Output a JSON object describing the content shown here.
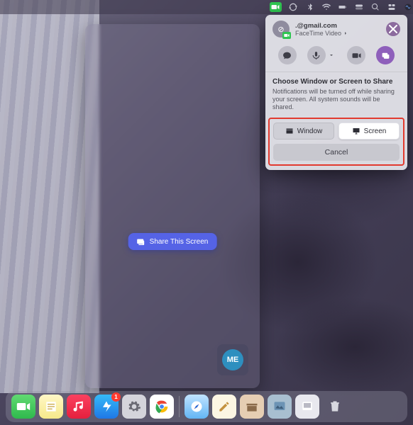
{
  "menubar": {
    "icons": [
      "facetime-icon",
      "sync-icon",
      "bluetooth-icon",
      "wifi-icon",
      "battery-icon",
      "toggle-icon",
      "search-icon",
      "control-center-icon",
      "siri-icon"
    ]
  },
  "hud": {
    "share_button": "Share This Screen",
    "avatar_initials": "ME"
  },
  "popover": {
    "caller_email": ".@gmail.com",
    "subtitle": "FaceTime Video",
    "heading": "Choose Window or Screen to Share",
    "description": "Notifications will be turned off while sharing your screen. All system sounds will be shared.",
    "window_label": "Window",
    "screen_label": "Screen",
    "cancel_label": "Cancel"
  },
  "dock": {
    "apps": [
      {
        "name": "FaceTime"
      },
      {
        "name": "Notes"
      },
      {
        "name": "Music"
      },
      {
        "name": "App Store",
        "badge": "1"
      },
      {
        "name": "System Settings"
      },
      {
        "name": "Chrome"
      }
    ],
    "recents": [
      {
        "name": "Safari"
      },
      {
        "name": "TextEdit"
      },
      {
        "name": "Archive"
      },
      {
        "name": "Wallpaper"
      },
      {
        "name": "Screenshot"
      },
      {
        "name": "Trash"
      }
    ]
  }
}
